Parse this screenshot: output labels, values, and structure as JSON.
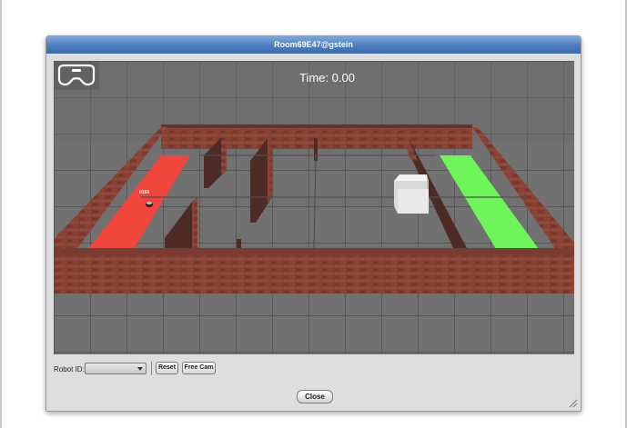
{
  "window": {
    "title": "Room69E47@gstein"
  },
  "scene": {
    "time_label": "Time: 0.00",
    "robot_label": "0169",
    "vr_icon": "vr-headset-icon",
    "colors": {
      "floor": "#6e6e6e",
      "brick": "#8c3f33",
      "start_zone": "#f0453a",
      "goal_zone": "#6ef55a",
      "box": "#f2f2f2"
    }
  },
  "controls": {
    "robot_id_label": "Robot ID:",
    "robot_id_value": "",
    "reset_label": "Reset",
    "free_cam_label": "Free Cam"
  },
  "footer": {
    "close_label": "Close"
  }
}
